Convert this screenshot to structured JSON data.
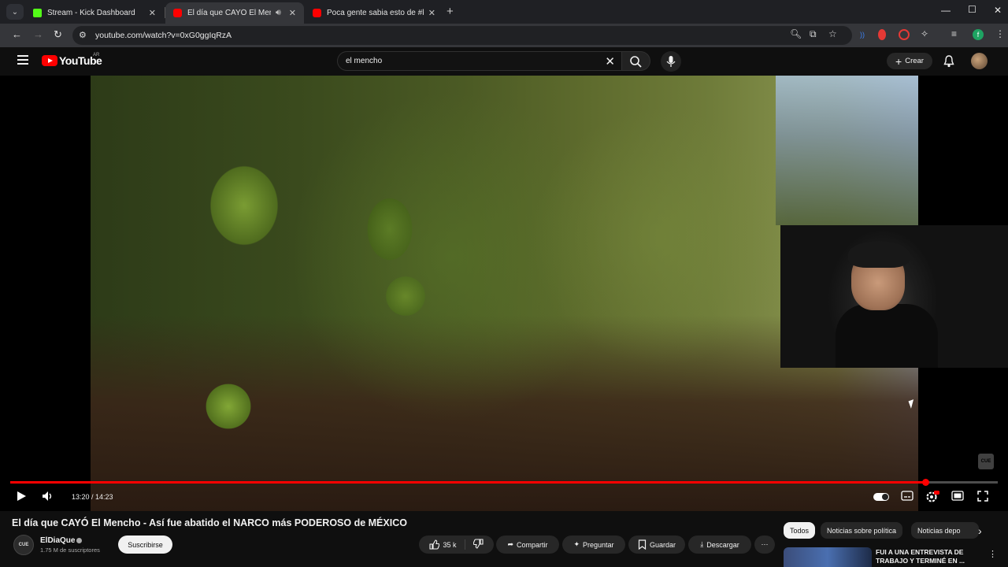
{
  "browser": {
    "tabs": [
      {
        "title": "Stream - Kick Dashboard",
        "color": "#53fc18"
      },
      {
        "title": "El día que CAYÓ El Mencho",
        "color": "#ff0000"
      },
      {
        "title": "Poca gente sabia esto de #kai",
        "color": "#ff0000"
      }
    ],
    "url": "youtube.com/watch?v=0xG0ggIqRzA"
  },
  "youtube": {
    "logo_text": "YouTube",
    "country": "AR",
    "search_query": "el mencho",
    "create_label": "Crear"
  },
  "player": {
    "time_display": "13:20 / 14:23",
    "progress_fraction": 0.927,
    "watermark": "CUE"
  },
  "video": {
    "title": "El día que CAYÓ El Mencho - Así fue abatido el NARCO más PODEROSO de MÉXICO",
    "channel_name": "ElDiaQue",
    "channel_avatar_text": "CUE",
    "subscribers": "1.75 M de suscriptores",
    "subscribe_label": "Suscribirse",
    "likes": "35 k",
    "share_label": "Compartir",
    "ask_label": "Preguntar",
    "save_label": "Guardar",
    "download_label": "Descargar"
  },
  "chips": [
    "Todos",
    "Noticias sobre política",
    "Noticias depo"
  ],
  "recommendation": {
    "title": "FUI A UNA ENTREVISTA DE TRABAJO Y TERMINÉ EN ..."
  }
}
